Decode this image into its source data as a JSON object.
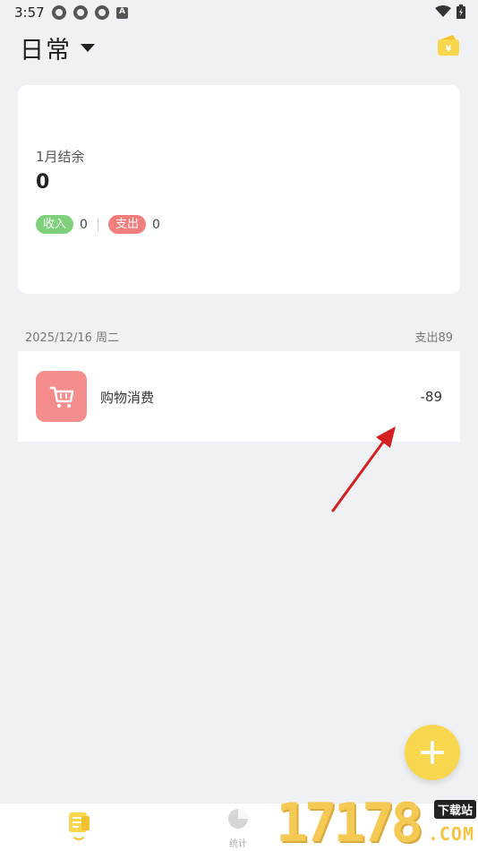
{
  "status_bar": {
    "time": "3:57",
    "icons": [
      "sync-icon",
      "sync-icon",
      "sync-icon",
      "a-icon"
    ],
    "right_icons": [
      "wifi-icon",
      "battery-icon"
    ]
  },
  "header": {
    "book_title": "日常",
    "dropdown_icon": "caret-down-icon",
    "wallet_icon": "wallet-icon"
  },
  "summary": {
    "month_label": "1月结余",
    "balance": "0",
    "income_label": "收入",
    "income_value": "0",
    "expense_label": "支出",
    "expense_value": "0"
  },
  "day_group": {
    "date": "2025/12/16 周二",
    "total": "支出89",
    "records": [
      {
        "icon": "shopping-cart-icon",
        "name": "购物消费",
        "amount": "-89"
      }
    ]
  },
  "fab": {
    "icon": "plus-icon"
  },
  "bottom_nav": {
    "tabs": [
      {
        "icon": "records-icon",
        "label": "",
        "active": true
      },
      {
        "icon": "pie-chart-icon",
        "label": "统计",
        "active": false
      }
    ]
  },
  "watermark": {
    "digits": "17178",
    "badge": "下载站",
    "suffix": ".COM"
  },
  "colors": {
    "background": "#f0f1f5",
    "accent_yellow": "#f8d74e",
    "income_green": "#7ed07a",
    "expense_red": "#f37e7e",
    "category_red": "#f58d8d",
    "arrow_red": "#d42020"
  }
}
